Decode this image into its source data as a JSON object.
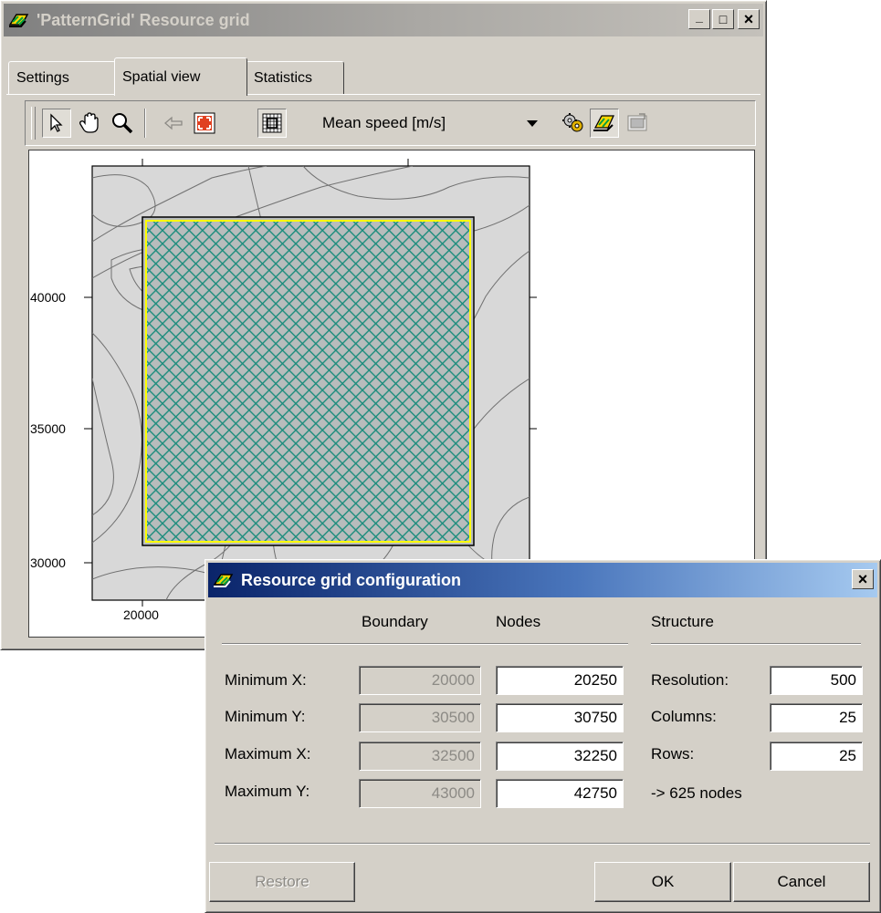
{
  "main_window": {
    "title": "'PatternGrid' Resource grid",
    "controls": {
      "minimize": "_",
      "maximize": "□",
      "close": "×"
    },
    "tabs": [
      {
        "label": "Settings",
        "active": false
      },
      {
        "label": "Spatial view",
        "active": true
      },
      {
        "label": "Statistics",
        "active": false
      }
    ],
    "toolbar": {
      "tools": [
        "pointer-icon",
        "pan-hand-icon",
        "zoom-icon",
        "back-arrow-icon",
        "zoom-extent-icon",
        "fit-grid-icon"
      ],
      "variable_selected": "Mean speed [m/s]",
      "right_tools": [
        "calculate-gears-icon",
        "resource-layer-icon",
        "export-image-icon"
      ]
    },
    "spatial_view": {
      "y_ticks": [
        "40000",
        "35000",
        "30000"
      ],
      "x_ticks": [
        "20000"
      ],
      "grid_color": "#1a8c7c",
      "boundary_color": "#ffff00",
      "background_color": "#d8d8d8"
    }
  },
  "dialog": {
    "title": "Resource grid configuration",
    "close": "×",
    "headers": {
      "boundary": "Boundary",
      "nodes": "Nodes",
      "structure": "Structure"
    },
    "rows": [
      {
        "label": "Minimum X:",
        "boundary": "20000",
        "nodes": "20250"
      },
      {
        "label": "Minimum Y:",
        "boundary": "30500",
        "nodes": "30750"
      },
      {
        "label": "Maximum X:",
        "boundary": "32500",
        "nodes": "32250"
      },
      {
        "label": "Maximum Y:",
        "boundary": "43000",
        "nodes": "42750"
      }
    ],
    "structure": [
      {
        "label": "Resolution:",
        "value": "500"
      },
      {
        "label": "Columns:",
        "value": "25"
      },
      {
        "label": "Rows:",
        "value": "25"
      }
    ],
    "node_count": "-> 625 nodes",
    "buttons": {
      "restore": "Restore",
      "ok": "OK",
      "cancel": "Cancel"
    }
  }
}
